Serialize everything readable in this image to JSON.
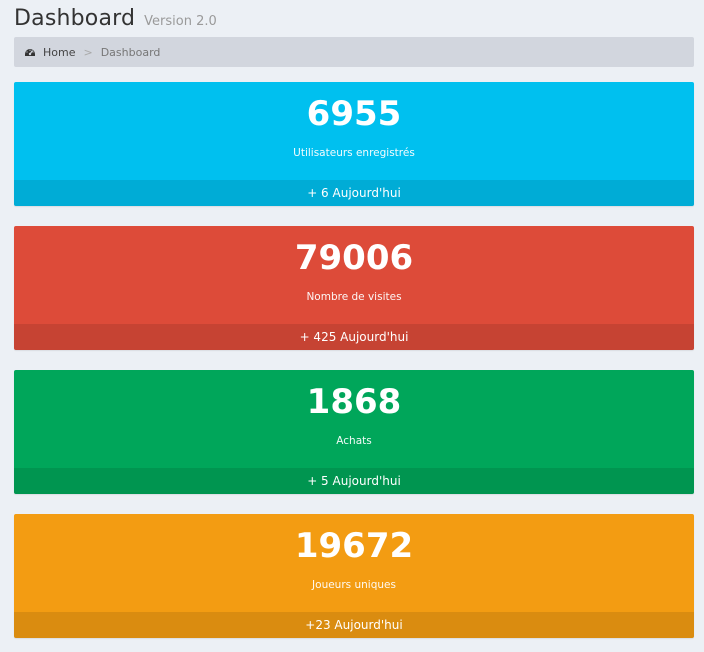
{
  "header": {
    "title": "Dashboard",
    "subtitle": "Version 2.0"
  },
  "breadcrumb": {
    "icon": "tachometer-icon",
    "home": "Home",
    "separator": ">",
    "current": "Dashboard"
  },
  "cards": [
    {
      "value": "6955",
      "label": "Utilisateurs enregistrés",
      "footer": "+ 6 Aujourd'hui",
      "color": "#00c0ef"
    },
    {
      "value": "79006",
      "label": "Nombre de visites",
      "footer": "+ 425 Aujourd'hui",
      "color": "#dd4b39"
    },
    {
      "value": "1868",
      "label": "Achats",
      "footer": "+ 5 Aujourd'hui",
      "color": "#00a65a"
    },
    {
      "value": "19672",
      "label": "Joueurs uniques",
      "footer": "+23 Aujourd'hui",
      "color": "#f39c12"
    }
  ]
}
